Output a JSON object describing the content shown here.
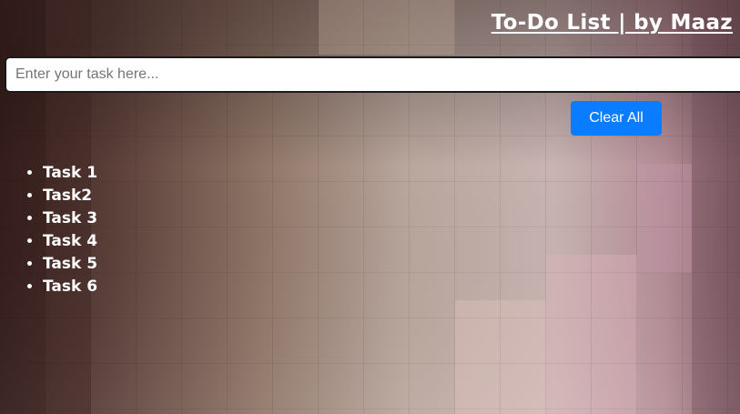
{
  "header": {
    "title": "To-Do List | by Maaz"
  },
  "input": {
    "placeholder": "Enter your task here...",
    "value": ""
  },
  "clear_button": {
    "label": "Clear All",
    "color": "#0a7cff"
  },
  "tasks": [
    "Task 1",
    "Task2",
    "Task 3",
    "Task 4",
    "Task 5",
    "Task 6"
  ]
}
